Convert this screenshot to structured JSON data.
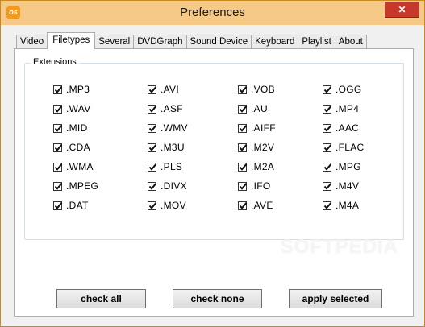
{
  "window": {
    "title": "Preferences",
    "close_label": "✕",
    "icon": "app-logo-icon",
    "icon_text": "os"
  },
  "tabs": [
    {
      "label": "Video"
    },
    {
      "label": "Filetypes",
      "active": true
    },
    {
      "label": "Several"
    },
    {
      "label": "DVDGraph"
    },
    {
      "label": "Sound Device"
    },
    {
      "label": "Keyboard"
    },
    {
      "label": "Playlist"
    },
    {
      "label": "About"
    }
  ],
  "extensions": {
    "legend": "Extensions",
    "columns": [
      [
        {
          "label": ".MP3",
          "checked": true
        },
        {
          "label": ".WAV",
          "checked": true
        },
        {
          "label": ".MID",
          "checked": true
        },
        {
          "label": ".CDA",
          "checked": true
        },
        {
          "label": ".WMA",
          "checked": true
        },
        {
          "label": ".MPEG",
          "checked": true
        },
        {
          "label": ".DAT",
          "checked": true
        }
      ],
      [
        {
          "label": ".AVI",
          "checked": true
        },
        {
          "label": ".ASF",
          "checked": true
        },
        {
          "label": ".WMV",
          "checked": true
        },
        {
          "label": ".M3U",
          "checked": true
        },
        {
          "label": ".PLS",
          "checked": true
        },
        {
          "label": ".DIVX",
          "checked": true
        },
        {
          "label": ".MOV",
          "checked": true
        }
      ],
      [
        {
          "label": ".VOB",
          "checked": true
        },
        {
          "label": ".AU",
          "checked": true
        },
        {
          "label": ".AIFF",
          "checked": true
        },
        {
          "label": ".M2V",
          "checked": true
        },
        {
          "label": ".M2A",
          "checked": true
        },
        {
          "label": ".IFO",
          "checked": true
        },
        {
          "label": ".AVE",
          "checked": true
        }
      ],
      [
        {
          "label": ".OGG",
          "checked": true
        },
        {
          "label": ".MP4",
          "checked": true
        },
        {
          "label": ".AAC",
          "checked": true
        },
        {
          "label": ".FLAC",
          "checked": true
        },
        {
          "label": ".MPG",
          "checked": true
        },
        {
          "label": ".M4V",
          "checked": true
        },
        {
          "label": ".M4A",
          "checked": true
        }
      ]
    ]
  },
  "buttons": {
    "check_all": "check all",
    "check_none": "check none",
    "apply_selected": "apply selected"
  },
  "watermark": "SOFTPEDIA"
}
